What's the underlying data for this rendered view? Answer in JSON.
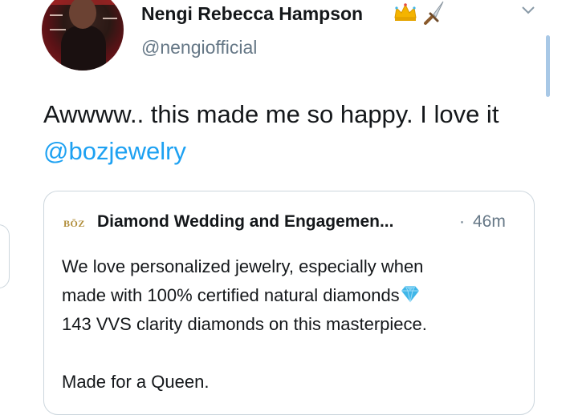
{
  "author": {
    "display_name": "Nengi Rebecca Hampson",
    "username": "@nengiofficial",
    "name_icons": [
      "crown-icon",
      "dagger-icon"
    ]
  },
  "tweet": {
    "text_before": "Awwww.. this made me so happy. I love it ",
    "mention": "@bozjewelry"
  },
  "quote": {
    "logo_text": "BŌZ",
    "author": "Diamond Wedding and Engagemen...",
    "separator": "·",
    "time": "46m",
    "line1": "We love personalized jewelry, especially when",
    "line2": "made with 100% certified natural diamonds",
    "line3": "143 VVS clarity diamonds on this masterpiece.",
    "line4": "Made for a Queen."
  },
  "colors": {
    "link": "#1da1f2",
    "secondary_text": "#657786",
    "border": "#ccd6dd",
    "diamond": "#3fb6e8"
  }
}
